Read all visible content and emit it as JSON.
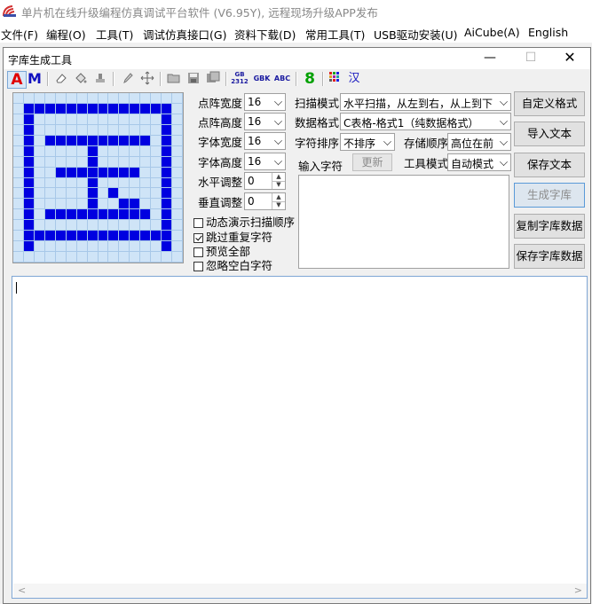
{
  "app": {
    "title": "单片机在线升级编程仿真调试平台软件 (V6.95Y), 远程现场升级APP发布",
    "menu": [
      "文件(F)",
      "编程(O)",
      "工具(T)",
      "调试仿真接口(G)",
      "资料下载(D)",
      "常用工具(T)",
      "USB驱动安装(U)",
      "AiCube(A)",
      "English"
    ]
  },
  "dialog": {
    "title": "字库生成工具",
    "toolbar": {
      "a_label": "A",
      "m_label": "M",
      "gb_label_top": "GB",
      "gb_label_bottom": "2312",
      "gbk_label": "GBK",
      "abc_label": "ABC",
      "eight_label": "8",
      "han_label": "汉"
    },
    "grid": {
      "size": 16,
      "on_cells": [
        [
          1,
          1
        ],
        [
          1,
          2
        ],
        [
          1,
          3
        ],
        [
          1,
          4
        ],
        [
          1,
          5
        ],
        [
          1,
          6
        ],
        [
          1,
          7
        ],
        [
          1,
          8
        ],
        [
          1,
          9
        ],
        [
          1,
          10
        ],
        [
          1,
          11
        ],
        [
          1,
          12
        ],
        [
          1,
          13
        ],
        [
          1,
          14
        ],
        [
          2,
          1
        ],
        [
          2,
          14
        ],
        [
          3,
          1
        ],
        [
          3,
          14
        ],
        [
          4,
          1
        ],
        [
          4,
          3
        ],
        [
          4,
          4
        ],
        [
          4,
          5
        ],
        [
          4,
          6
        ],
        [
          4,
          7
        ],
        [
          4,
          8
        ],
        [
          4,
          9
        ],
        [
          4,
          10
        ],
        [
          4,
          11
        ],
        [
          4,
          12
        ],
        [
          4,
          14
        ],
        [
          5,
          1
        ],
        [
          5,
          7
        ],
        [
          5,
          14
        ],
        [
          6,
          1
        ],
        [
          6,
          7
        ],
        [
          6,
          14
        ],
        [
          7,
          1
        ],
        [
          7,
          4
        ],
        [
          7,
          5
        ],
        [
          7,
          6
        ],
        [
          7,
          7
        ],
        [
          7,
          8
        ],
        [
          7,
          9
        ],
        [
          7,
          10
        ],
        [
          7,
          11
        ],
        [
          7,
          14
        ],
        [
          8,
          1
        ],
        [
          8,
          7
        ],
        [
          8,
          14
        ],
        [
          9,
          1
        ],
        [
          9,
          7
        ],
        [
          9,
          9
        ],
        [
          9,
          14
        ],
        [
          10,
          1
        ],
        [
          10,
          7
        ],
        [
          10,
          10
        ],
        [
          10,
          11
        ],
        [
          10,
          14
        ],
        [
          11,
          1
        ],
        [
          11,
          3
        ],
        [
          11,
          4
        ],
        [
          11,
          5
        ],
        [
          11,
          6
        ],
        [
          11,
          7
        ],
        [
          11,
          8
        ],
        [
          11,
          9
        ],
        [
          11,
          10
        ],
        [
          11,
          11
        ],
        [
          11,
          12
        ],
        [
          11,
          14
        ],
        [
          12,
          1
        ],
        [
          12,
          14
        ],
        [
          13,
          1
        ],
        [
          13,
          2
        ],
        [
          13,
          3
        ],
        [
          13,
          4
        ],
        [
          13,
          5
        ],
        [
          13,
          6
        ],
        [
          13,
          7
        ],
        [
          13,
          8
        ],
        [
          13,
          9
        ],
        [
          13,
          10
        ],
        [
          13,
          11
        ],
        [
          13,
          12
        ],
        [
          13,
          13
        ],
        [
          13,
          14
        ],
        [
          14,
          1
        ],
        [
          14,
          14
        ]
      ]
    },
    "fields": {
      "matrix_width_label": "点阵宽度",
      "matrix_width": "16",
      "matrix_height_label": "点阵高度",
      "matrix_height": "16",
      "font_width_label": "字体宽度",
      "font_width": "16",
      "font_height_label": "字体高度",
      "font_height": "16",
      "h_adjust_label": "水平调整",
      "h_adjust": "0",
      "v_adjust_label": "垂直调整",
      "v_adjust": "0",
      "scan_mode_label": "扫描模式",
      "scan_mode": "水平扫描，从左到右，从上到下",
      "data_format_label": "数据格式",
      "data_format": "C表格-格式1（纯数据格式）",
      "char_sort_label": "字符排序",
      "char_sort": "不排序",
      "storage_order_label": "存储顺序",
      "storage_order": "高位在前",
      "input_chars_label": "输入字符",
      "tool_mode_label": "工具模式",
      "tool_mode": "自动模式"
    },
    "checkboxes": [
      {
        "label": "动态演示扫描顺序",
        "checked": false
      },
      {
        "label": "跳过重复字符",
        "checked": true
      },
      {
        "label": "预览全部",
        "checked": false
      },
      {
        "label": "忽略空白字符",
        "checked": false
      }
    ],
    "buttons": {
      "update": "更新",
      "custom_format": "自定义格式",
      "import_text": "导入文本",
      "save_text": "保存文本",
      "generate": "生成字库",
      "copy_data": "复制字库数据",
      "save_data": "保存字库数据"
    }
  }
}
